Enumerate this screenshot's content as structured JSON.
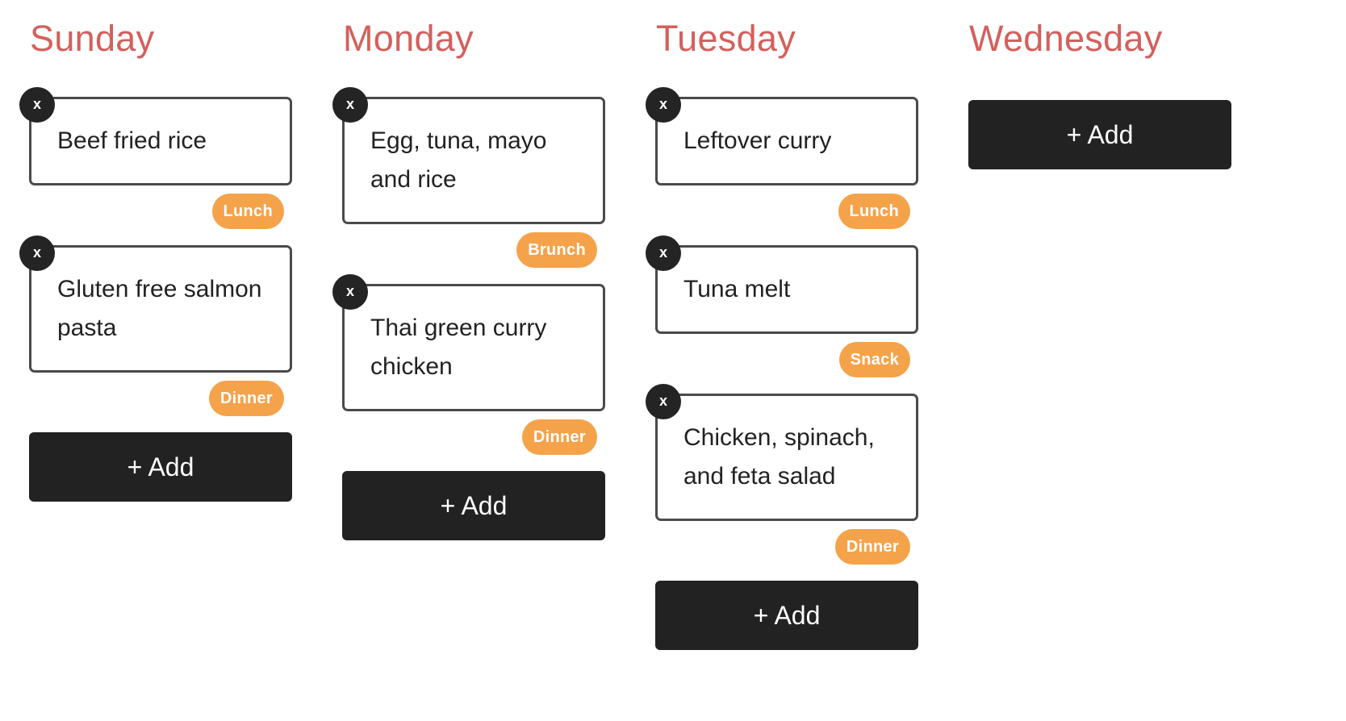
{
  "days": [
    {
      "name": "Sunday",
      "meals": [
        {
          "text": "Beef fried rice",
          "tag": "Lunch"
        },
        {
          "text": "Gluten free salmon pasta",
          "tag": "Dinner"
        }
      ],
      "add_label": "+ Add"
    },
    {
      "name": "Monday",
      "meals": [
        {
          "text": "Egg, tuna, mayo and rice",
          "tag": "Brunch"
        },
        {
          "text": "Thai green curry chicken",
          "tag": "Dinner"
        }
      ],
      "add_label": "+ Add"
    },
    {
      "name": "Tuesday",
      "meals": [
        {
          "text": "Leftover curry",
          "tag": "Lunch"
        },
        {
          "text": "Tuna melt",
          "tag": "Snack"
        },
        {
          "text": "Chicken, spinach, and feta salad",
          "tag": "Dinner"
        }
      ],
      "add_label": "+ Add"
    },
    {
      "name": "Wednesday",
      "meals": [],
      "add_label": "+ Add"
    }
  ],
  "remove_label": "x",
  "colors": {
    "day_title": "#d4605c",
    "tag": "#f4a34b",
    "button": "#222222",
    "card_border": "#4a4a4a"
  }
}
